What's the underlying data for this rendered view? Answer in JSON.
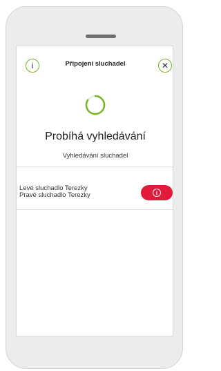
{
  "header": {
    "title": "Připojení sluchadel",
    "info_icon": "info-icon",
    "close_icon": "close-icon"
  },
  "status": {
    "title": "Probíhá vyhledávání",
    "subtitle": "Vyhledávání sluchadel"
  },
  "devices": {
    "left": "Levé sluchadlo Terezky",
    "right": "Pravé sluchadlo Terezky",
    "action_icon": "warning-info-icon"
  },
  "colors": {
    "accent": "#78b324",
    "alert": "#e31b3a"
  }
}
